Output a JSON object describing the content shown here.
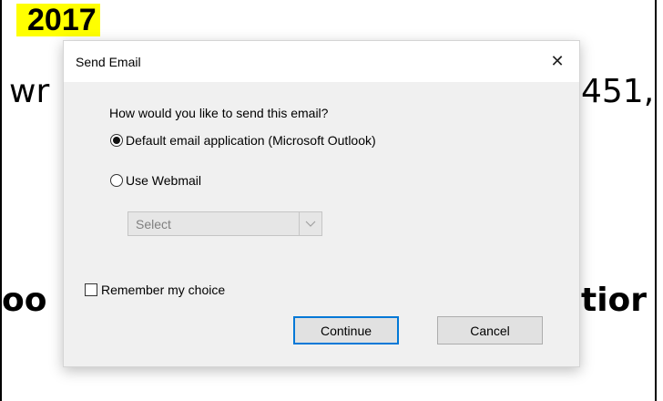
{
  "background": {
    "year": "2017",
    "line1_left": "wr",
    "line1_right": "451,",
    "line2_left": "oo",
    "line2_right": "tior"
  },
  "dialog": {
    "title": "Send Email",
    "close_glyph": "✕",
    "question": "How would you like to send this email?",
    "options": [
      {
        "label": "Default email application (Microsoft Outlook)",
        "checked": true
      },
      {
        "label": "Use Webmail",
        "checked": false
      }
    ],
    "webmail_select": {
      "value": "Select",
      "disabled": true
    },
    "remember": {
      "label": "Remember my choice",
      "checked": false
    },
    "buttons": {
      "continue": "Continue",
      "cancel": "Cancel"
    }
  },
  "colors": {
    "highlight": "#ffff00",
    "focus_border": "#0078d7",
    "dialog_bg": "#f0f0f0"
  }
}
